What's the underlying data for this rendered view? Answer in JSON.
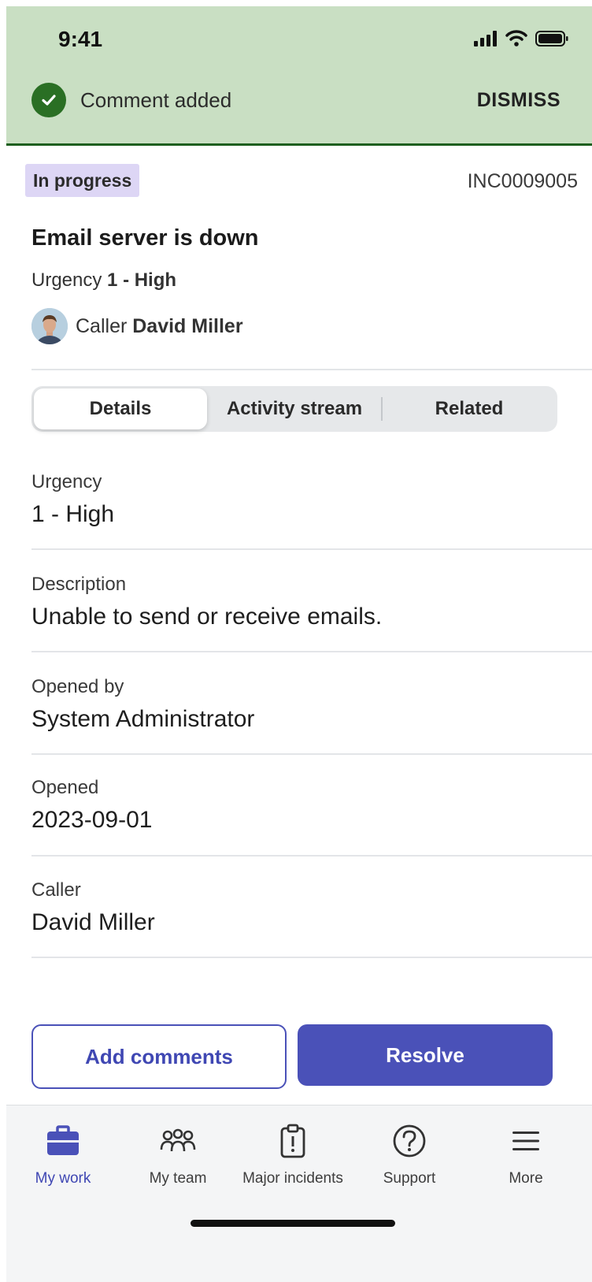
{
  "status_bar": {
    "time": "9:41"
  },
  "toast": {
    "message": "Comment added",
    "dismiss_label": "DISMISS"
  },
  "incident": {
    "state": "In progress",
    "number": "INC0009005",
    "title": "Email server is down",
    "urgency_label": "Urgency",
    "urgency_value": "1 - High",
    "caller_label": "Caller",
    "caller_name": "David Miller"
  },
  "tabs": [
    {
      "label": "Details",
      "active": true
    },
    {
      "label": "Activity stream",
      "active": false
    },
    {
      "label": "Related",
      "active": false
    }
  ],
  "details": [
    {
      "label": "Urgency",
      "value": "1 - High"
    },
    {
      "label": "Description",
      "value": "Unable to send or receive emails."
    },
    {
      "label": "Opened by",
      "value": "System Administrator"
    },
    {
      "label": "Opened",
      "value": "2023-09-01"
    },
    {
      "label": "Caller",
      "value": "David Miller"
    }
  ],
  "actions": {
    "add_comments": "Add comments",
    "resolve": "Resolve"
  },
  "nav": [
    {
      "label": "My work",
      "icon": "briefcase-icon",
      "active": true
    },
    {
      "label": "My team",
      "icon": "team-icon",
      "active": false
    },
    {
      "label": "Major incidents",
      "icon": "clipboard-alert-icon",
      "active": false
    },
    {
      "label": "Support",
      "icon": "help-circle-icon",
      "active": false
    },
    {
      "label": "More",
      "icon": "menu-icon",
      "active": false
    }
  ],
  "colors": {
    "banner": "#c9dfc3",
    "accent": "#4a51b8",
    "success": "#2a6f24",
    "badge": "#ddd6f5"
  }
}
